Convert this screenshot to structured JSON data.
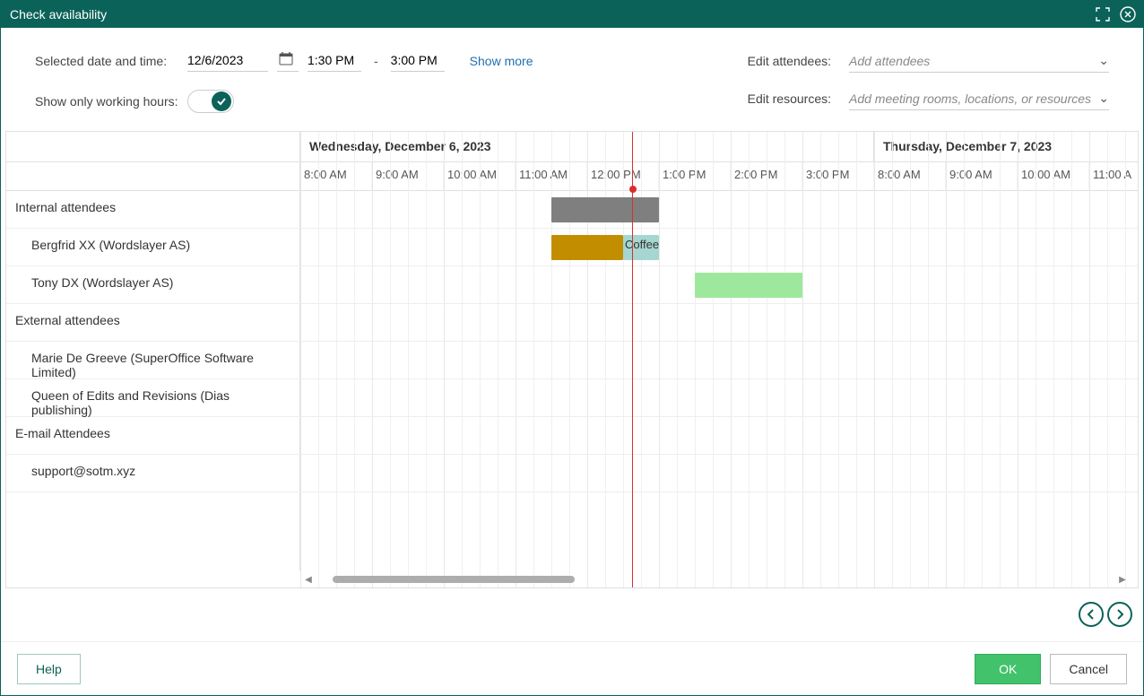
{
  "title": "Check availability",
  "labels": {
    "selected_date_time": "Selected date and time:",
    "working_hours": "Show only working hours:",
    "edit_attendees": "Edit attendees:",
    "edit_resources": "Edit resources:",
    "show_more": "Show more",
    "dash": "-"
  },
  "date": "12/6/2023",
  "time_start": "1:30 PM",
  "time_end": "3:00 PM",
  "placeholders": {
    "attendees": "Add attendees",
    "resources": "Add meeting rooms, locations, or resources"
  },
  "days": {
    "day1": "Wednesday, December 6, 2023",
    "day2": "Thursday, December 7, 2023"
  },
  "hours_day1": [
    "8:00 AM",
    "9:00 AM",
    "10:00 AM",
    "11:00 AM",
    "12:00 PM",
    "1:00 PM",
    "2:00 PM",
    "3:00 PM"
  ],
  "hours_day2": [
    "8:00 AM",
    "9:00 AM",
    "10:00 AM",
    "11:00 A"
  ],
  "groups": {
    "internal": "Internal attendees",
    "external": "External attendees",
    "email": "E-mail Attendees"
  },
  "people": {
    "p1": "Bergfrid XX (Wordslayer AS)",
    "p2": "Tony DX (Wordslayer AS)",
    "p3": "Marie De Greeve (SuperOffice Software Limited)",
    "p4": "Queen of Edits and Revisions (Dias publishing)",
    "p5": "support@sotm.xyz"
  },
  "block_coffee_label": "Coffee",
  "buttons": {
    "help": "Help",
    "ok": "OK",
    "cancel": "Cancel"
  }
}
